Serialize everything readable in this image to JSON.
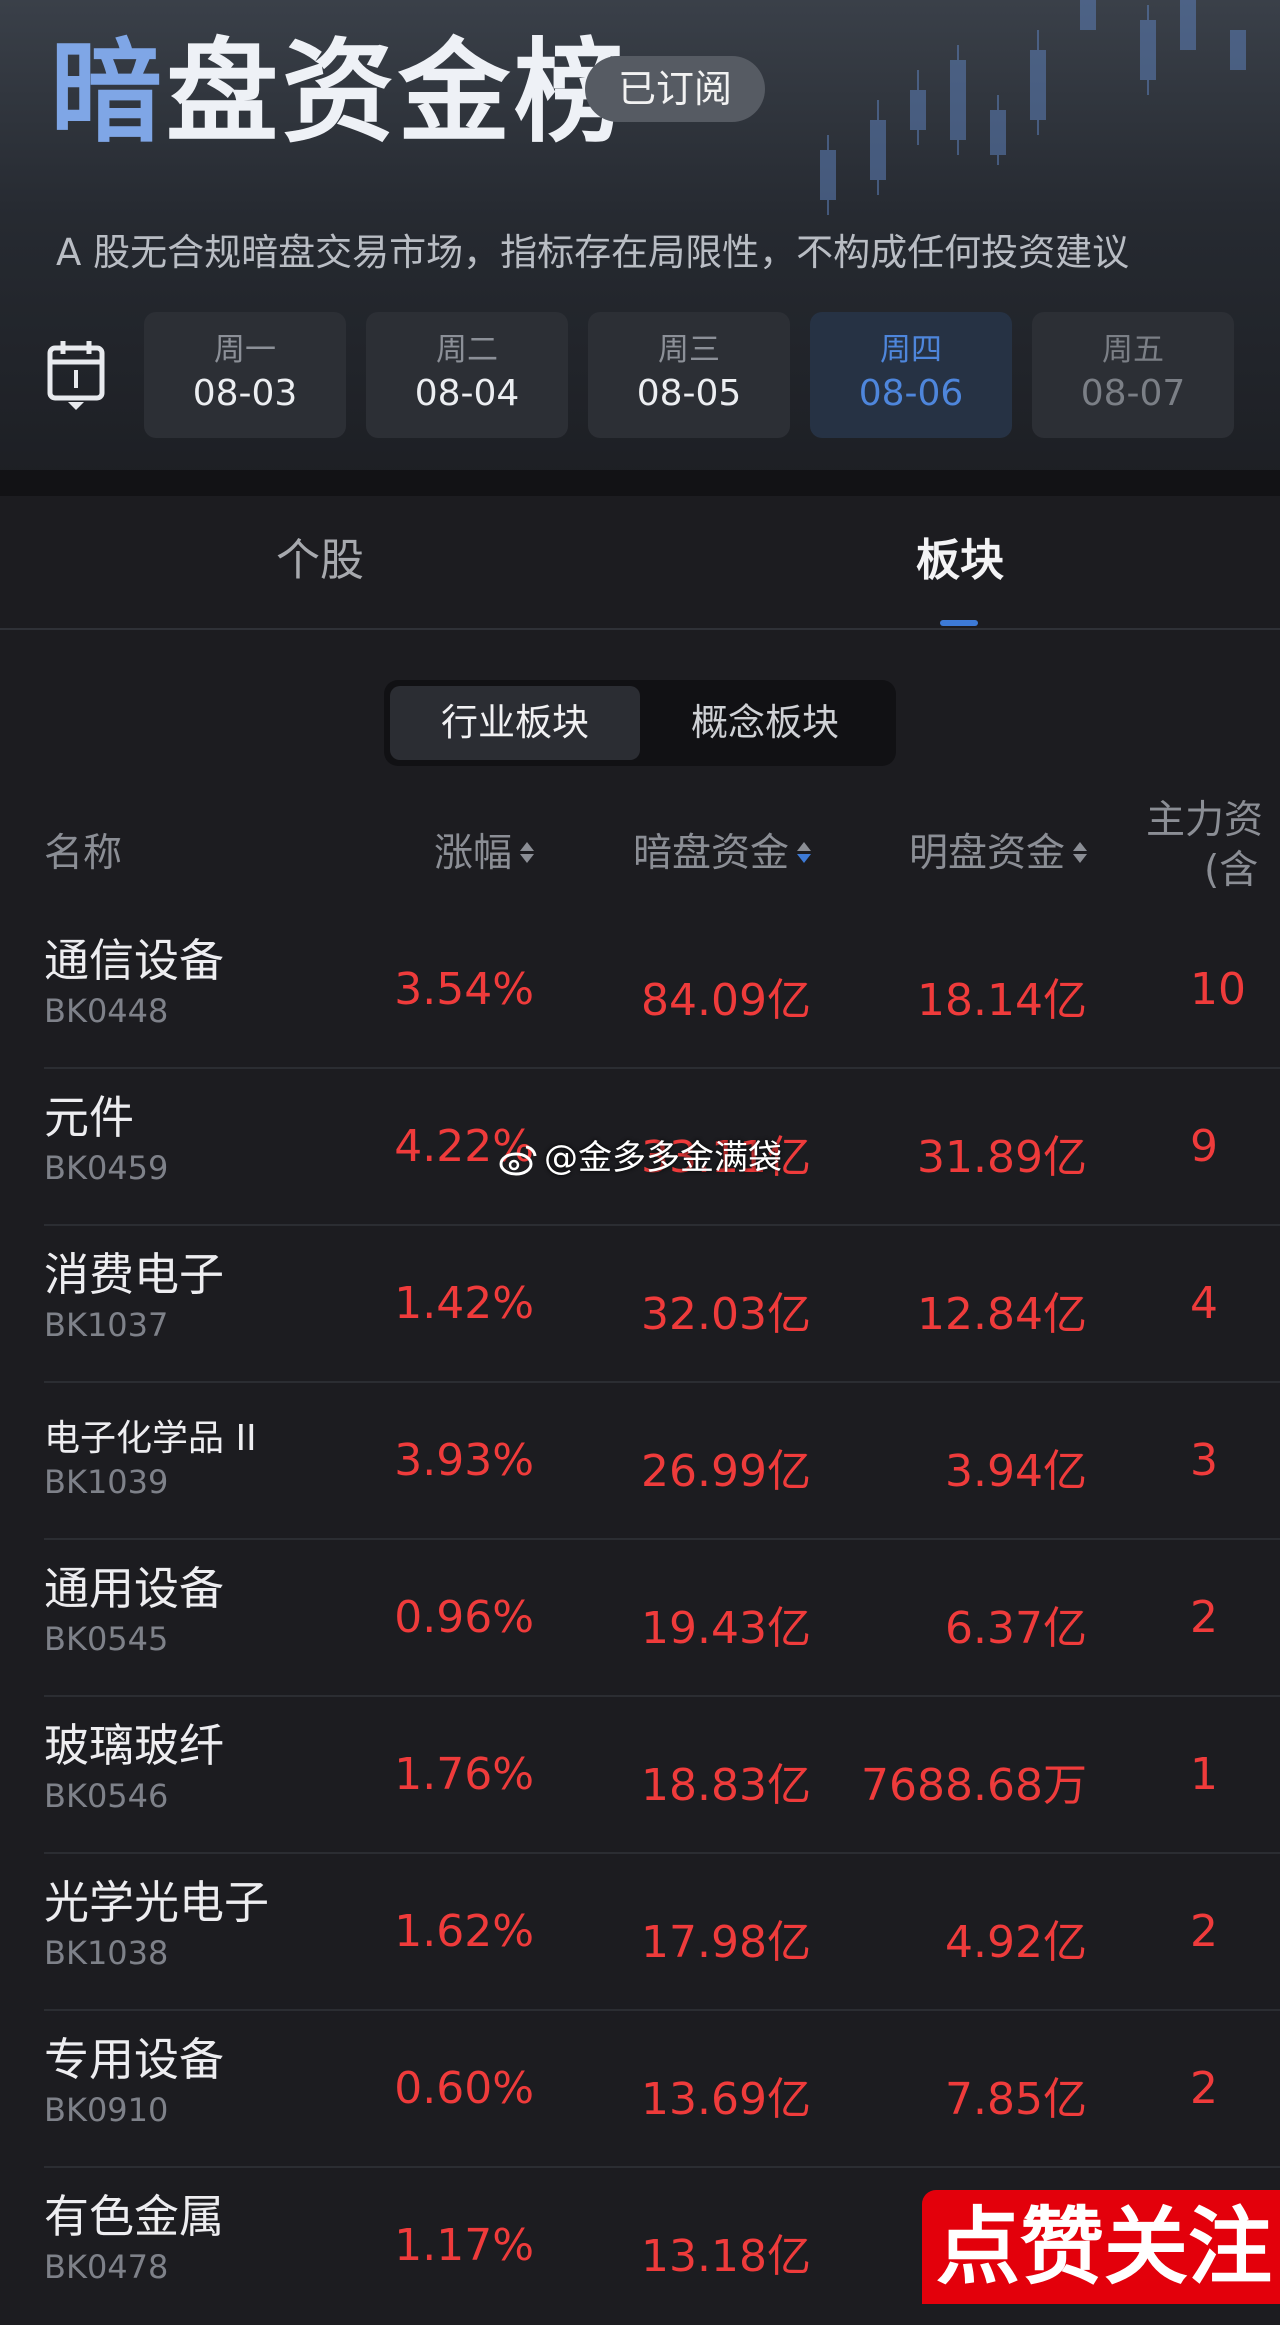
{
  "header": {
    "title": "暗盘资金榜",
    "badge": "已订阅",
    "disclaimer": "A 股无合规暗盘交易市场，指标存在局限性，不构成任何投资建议"
  },
  "days": [
    {
      "weekday": "周一",
      "date": "08-03"
    },
    {
      "weekday": "周二",
      "date": "08-04"
    },
    {
      "weekday": "周三",
      "date": "08-05"
    },
    {
      "weekday": "周四",
      "date": "08-06"
    },
    {
      "weekday": "周五",
      "date": "08-07"
    }
  ],
  "active_day": "周四",
  "tabs": {
    "stock": "个股",
    "sector": "板块"
  },
  "segment": {
    "industry": "行业板块",
    "concept": "概念板块"
  },
  "columns": {
    "name": "名称",
    "change": "涨幅",
    "dark_funds": "暗盘资金",
    "lit_funds": "明盘资金",
    "main_funds": "主力资",
    "main_funds_sub": "(含"
  },
  "rows": [
    {
      "name": "通信设备",
      "code": "BK0448",
      "change": "3.54%",
      "dark": "84.09亿",
      "lit": "18.14亿",
      "main": "10"
    },
    {
      "name": "元件",
      "code": "BK0459",
      "change": "4.22%",
      "dark": "33.11亿",
      "lit": "31.89亿",
      "main": "9"
    },
    {
      "name": "消费电子",
      "code": "BK1037",
      "change": "1.42%",
      "dark": "32.03亿",
      "lit": "12.84亿",
      "main": "4"
    },
    {
      "name": "电子化学品 II",
      "code": "BK1039",
      "change": "3.93%",
      "dark": "26.99亿",
      "lit": "3.94亿",
      "main": "3"
    },
    {
      "name": "通用设备",
      "code": "BK0545",
      "change": "0.96%",
      "dark": "19.43亿",
      "lit": "6.37亿",
      "main": "2"
    },
    {
      "name": "玻璃玻纤",
      "code": "BK0546",
      "change": "1.76%",
      "dark": "18.83亿",
      "lit": "7688.68万",
      "main": "1"
    },
    {
      "name": "光学光电子",
      "code": "BK1038",
      "change": "1.62%",
      "dark": "17.98亿",
      "lit": "4.92亿",
      "main": "2"
    },
    {
      "name": "专用设备",
      "code": "BK0910",
      "change": "0.60%",
      "dark": "13.69亿",
      "lit": "7.85亿",
      "main": "2"
    },
    {
      "name": "有色金属",
      "code": "BK0478",
      "change": "1.17%",
      "dark": "13.18亿",
      "lit": "",
      "main": ""
    }
  ],
  "watermark": "@金多多金满袋",
  "follow_banner": "点赞关注",
  "colors": {
    "up": "#ef3b3b",
    "accent": "#3d7ad6",
    "banner": "#e3000b"
  }
}
